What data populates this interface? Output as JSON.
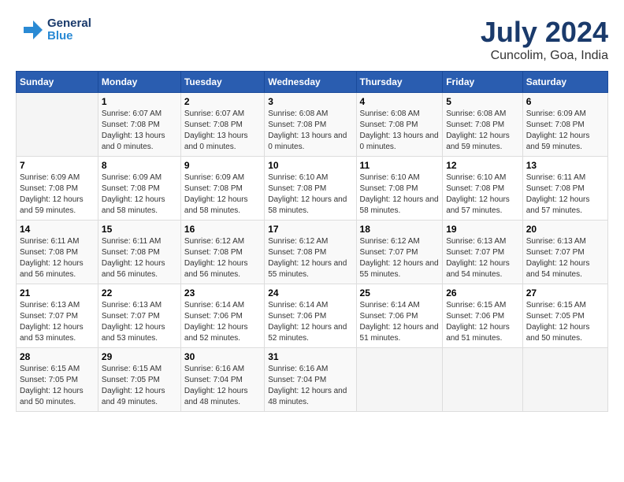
{
  "header": {
    "logo_line1": "General",
    "logo_line2": "Blue",
    "month": "July 2024",
    "location": "Cuncolim, Goa, India"
  },
  "days_of_week": [
    "Sunday",
    "Monday",
    "Tuesday",
    "Wednesday",
    "Thursday",
    "Friday",
    "Saturday"
  ],
  "weeks": [
    [
      {
        "day": "",
        "empty": true
      },
      {
        "day": "1",
        "sunrise": "6:07 AM",
        "sunset": "7:08 PM",
        "daylight": "13 hours and 0 minutes."
      },
      {
        "day": "2",
        "sunrise": "6:07 AM",
        "sunset": "7:08 PM",
        "daylight": "13 hours and 0 minutes."
      },
      {
        "day": "3",
        "sunrise": "6:08 AM",
        "sunset": "7:08 PM",
        "daylight": "13 hours and 0 minutes."
      },
      {
        "day": "4",
        "sunrise": "6:08 AM",
        "sunset": "7:08 PM",
        "daylight": "13 hours and 0 minutes."
      },
      {
        "day": "5",
        "sunrise": "6:08 AM",
        "sunset": "7:08 PM",
        "daylight": "12 hours and 59 minutes."
      },
      {
        "day": "6",
        "sunrise": "6:09 AM",
        "sunset": "7:08 PM",
        "daylight": "12 hours and 59 minutes."
      }
    ],
    [
      {
        "day": "7",
        "sunrise": "6:09 AM",
        "sunset": "7:08 PM",
        "daylight": "12 hours and 59 minutes."
      },
      {
        "day": "8",
        "sunrise": "6:09 AM",
        "sunset": "7:08 PM",
        "daylight": "12 hours and 58 minutes."
      },
      {
        "day": "9",
        "sunrise": "6:09 AM",
        "sunset": "7:08 PM",
        "daylight": "12 hours and 58 minutes."
      },
      {
        "day": "10",
        "sunrise": "6:10 AM",
        "sunset": "7:08 PM",
        "daylight": "12 hours and 58 minutes."
      },
      {
        "day": "11",
        "sunrise": "6:10 AM",
        "sunset": "7:08 PM",
        "daylight": "12 hours and 58 minutes."
      },
      {
        "day": "12",
        "sunrise": "6:10 AM",
        "sunset": "7:08 PM",
        "daylight": "12 hours and 57 minutes."
      },
      {
        "day": "13",
        "sunrise": "6:11 AM",
        "sunset": "7:08 PM",
        "daylight": "12 hours and 57 minutes."
      }
    ],
    [
      {
        "day": "14",
        "sunrise": "6:11 AM",
        "sunset": "7:08 PM",
        "daylight": "12 hours and 56 minutes."
      },
      {
        "day": "15",
        "sunrise": "6:11 AM",
        "sunset": "7:08 PM",
        "daylight": "12 hours and 56 minutes."
      },
      {
        "day": "16",
        "sunrise": "6:12 AM",
        "sunset": "7:08 PM",
        "daylight": "12 hours and 56 minutes."
      },
      {
        "day": "17",
        "sunrise": "6:12 AM",
        "sunset": "7:08 PM",
        "daylight": "12 hours and 55 minutes."
      },
      {
        "day": "18",
        "sunrise": "6:12 AM",
        "sunset": "7:07 PM",
        "daylight": "12 hours and 55 minutes."
      },
      {
        "day": "19",
        "sunrise": "6:13 AM",
        "sunset": "7:07 PM",
        "daylight": "12 hours and 54 minutes."
      },
      {
        "day": "20",
        "sunrise": "6:13 AM",
        "sunset": "7:07 PM",
        "daylight": "12 hours and 54 minutes."
      }
    ],
    [
      {
        "day": "21",
        "sunrise": "6:13 AM",
        "sunset": "7:07 PM",
        "daylight": "12 hours and 53 minutes."
      },
      {
        "day": "22",
        "sunrise": "6:13 AM",
        "sunset": "7:07 PM",
        "daylight": "12 hours and 53 minutes."
      },
      {
        "day": "23",
        "sunrise": "6:14 AM",
        "sunset": "7:06 PM",
        "daylight": "12 hours and 52 minutes."
      },
      {
        "day": "24",
        "sunrise": "6:14 AM",
        "sunset": "7:06 PM",
        "daylight": "12 hours and 52 minutes."
      },
      {
        "day": "25",
        "sunrise": "6:14 AM",
        "sunset": "7:06 PM",
        "daylight": "12 hours and 51 minutes."
      },
      {
        "day": "26",
        "sunrise": "6:15 AM",
        "sunset": "7:06 PM",
        "daylight": "12 hours and 51 minutes."
      },
      {
        "day": "27",
        "sunrise": "6:15 AM",
        "sunset": "7:05 PM",
        "daylight": "12 hours and 50 minutes."
      }
    ],
    [
      {
        "day": "28",
        "sunrise": "6:15 AM",
        "sunset": "7:05 PM",
        "daylight": "12 hours and 50 minutes."
      },
      {
        "day": "29",
        "sunrise": "6:15 AM",
        "sunset": "7:05 PM",
        "daylight": "12 hours and 49 minutes."
      },
      {
        "day": "30",
        "sunrise": "6:16 AM",
        "sunset": "7:04 PM",
        "daylight": "12 hours and 48 minutes."
      },
      {
        "day": "31",
        "sunrise": "6:16 AM",
        "sunset": "7:04 PM",
        "daylight": "12 hours and 48 minutes."
      },
      {
        "day": "",
        "empty": true
      },
      {
        "day": "",
        "empty": true
      },
      {
        "day": "",
        "empty": true
      }
    ]
  ]
}
